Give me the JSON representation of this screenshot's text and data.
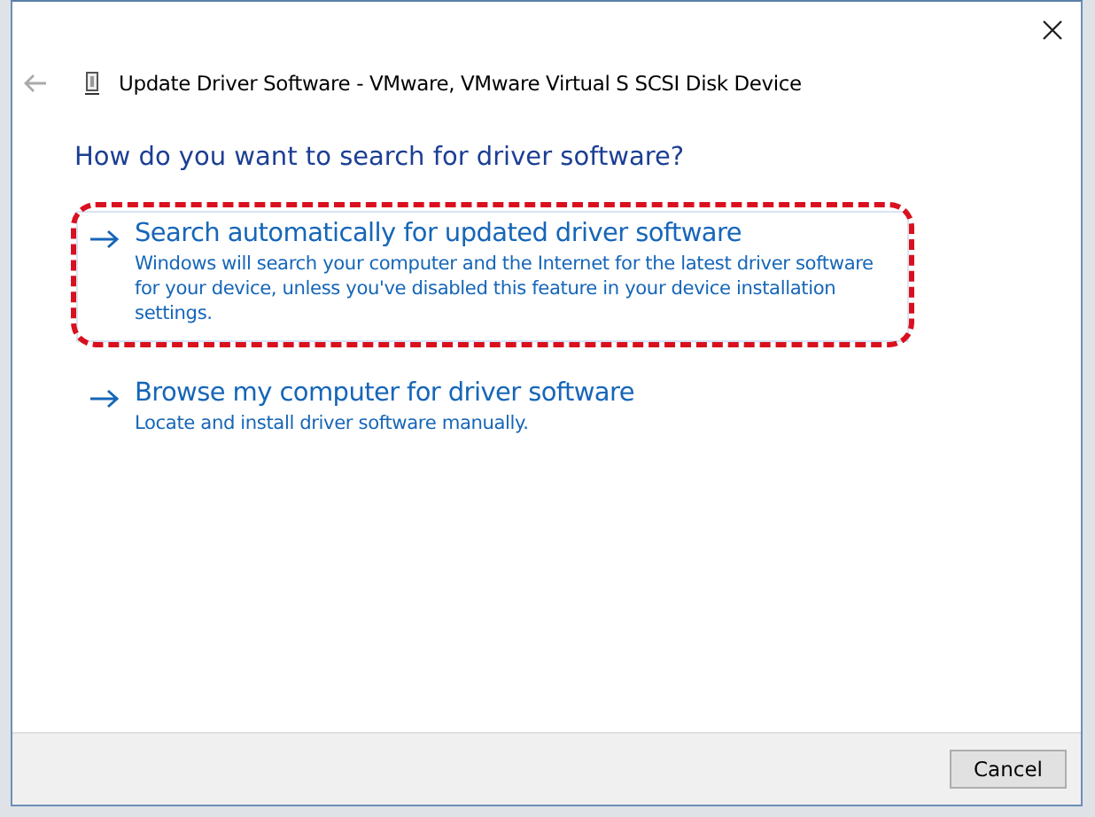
{
  "window": {
    "title": "Update Driver Software - VMware, VMware Virtual S SCSI Disk Device"
  },
  "heading": "How do you want to search for driver software?",
  "options": [
    {
      "title": "Search automatically for updated driver software",
      "description": "Windows will search your computer and the Internet for the latest driver software for your device, unless you've disabled this feature in your device installation settings.",
      "selected": true,
      "highlighted": true
    },
    {
      "title": "Browse my computer for driver software",
      "description": "Locate and install driver software manually.",
      "selected": false,
      "highlighted": false
    }
  ],
  "buttons": [
    "Cancel"
  ]
}
